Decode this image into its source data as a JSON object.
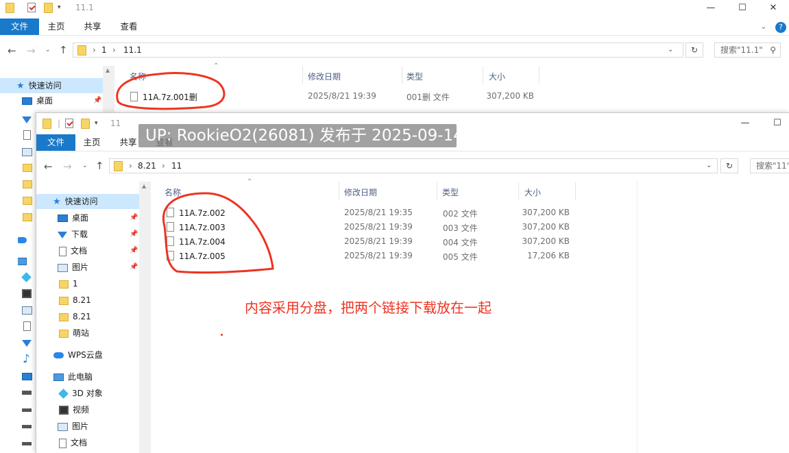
{
  "back": {
    "title": "11.1",
    "ribbon_tabs": [
      "文件",
      "主页",
      "共享",
      "查看"
    ],
    "breadcrumb": [
      "1",
      "11.1"
    ],
    "search_placeholder": "搜索\"11.1\"",
    "nav": {
      "quick_access": "快速访问",
      "desktop": "桌面"
    },
    "columns": [
      "名称",
      "修改日期",
      "类型",
      "大小"
    ],
    "files": [
      {
        "name": "11A.7z.001删",
        "date": "2025/8/21 19:39",
        "type": "001删 文件",
        "size": "307,200 KB"
      }
    ]
  },
  "front": {
    "title": "11",
    "ribbon_tabs": [
      "文件",
      "主页",
      "共享",
      "查看"
    ],
    "breadcrumb": [
      "8.21",
      "11"
    ],
    "search_placeholder": "搜索\"11\"",
    "nav": {
      "quick_access": "快速访问",
      "items": [
        "桌面",
        "下载",
        "文档",
        "图片",
        "1",
        "8.21",
        "8.21",
        "萌站"
      ],
      "wps": "WPS云盘",
      "this_pc": "此电脑",
      "pc_items": [
        "3D 对象",
        "视频",
        "图片",
        "文档"
      ]
    },
    "columns": [
      "名称",
      "修改日期",
      "类型",
      "大小"
    ],
    "files": [
      {
        "name": "11A.7z.002",
        "date": "2025/8/21 19:35",
        "type": "002 文件",
        "size": "307,200 KB"
      },
      {
        "name": "11A.7z.003",
        "date": "2025/8/21 19:39",
        "type": "003 文件",
        "size": "307,200 KB"
      },
      {
        "name": "11A.7z.004",
        "date": "2025/8/21 19:39",
        "type": "004 文件",
        "size": "307,200 KB"
      },
      {
        "name": "11A.7z.005",
        "date": "2025/8/21 19:39",
        "type": "005 文件",
        "size": "17,206 KB"
      }
    ]
  },
  "watermark": "UP: RookieO2(26081) 发布于 2025-09-14",
  "annotation_note": "内容采用分盘，把两个链接下载放在一起",
  "colors": {
    "accent": "#1979ca",
    "annotation": "#ee3322",
    "selection": "#cce8ff"
  }
}
